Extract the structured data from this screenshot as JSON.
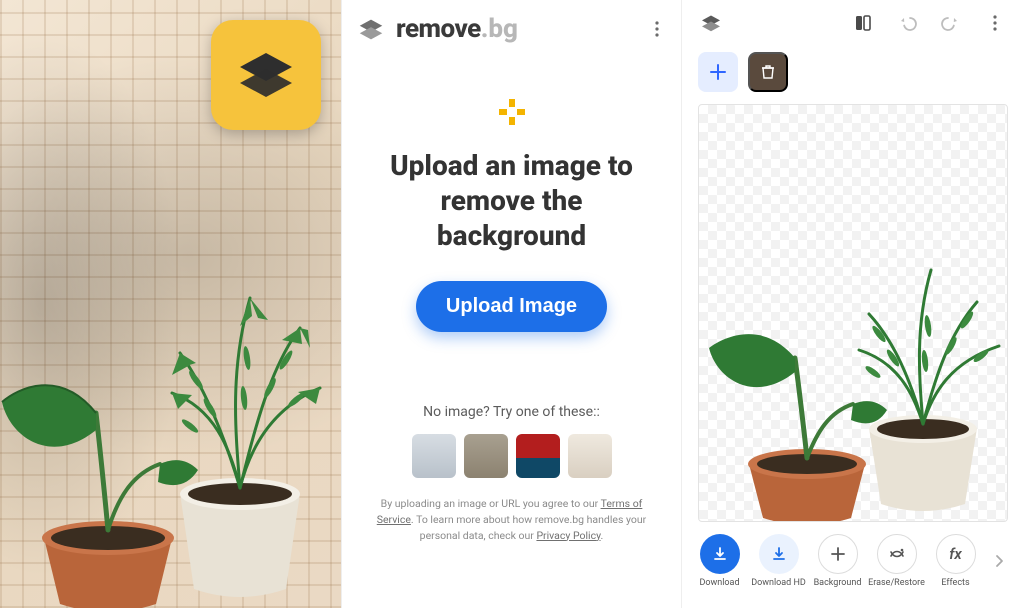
{
  "brand": {
    "word": "remove",
    "suffix": ".bg"
  },
  "headline": "Upload an image to remove the background",
  "upload_button": "Upload Image",
  "try_line": "No image? Try one of these::",
  "legal": {
    "pre": "By uploading an image or URL you agree to our ",
    "tos": "Terms of Service",
    "mid": ". To learn more about how remove.bg handles your personal data, check our ",
    "pp": "Privacy Policy",
    "post": "."
  },
  "samples": [
    "sample-1",
    "sample-2",
    "sample-3",
    "sample-4"
  ],
  "editor": {
    "actions": [
      {
        "key": "download",
        "label": "Download"
      },
      {
        "key": "download_hd",
        "label": "Download HD"
      },
      {
        "key": "background",
        "label": "Background"
      },
      {
        "key": "erase",
        "label": "Erase/Restore"
      },
      {
        "key": "effects",
        "label": "Effects"
      }
    ]
  }
}
